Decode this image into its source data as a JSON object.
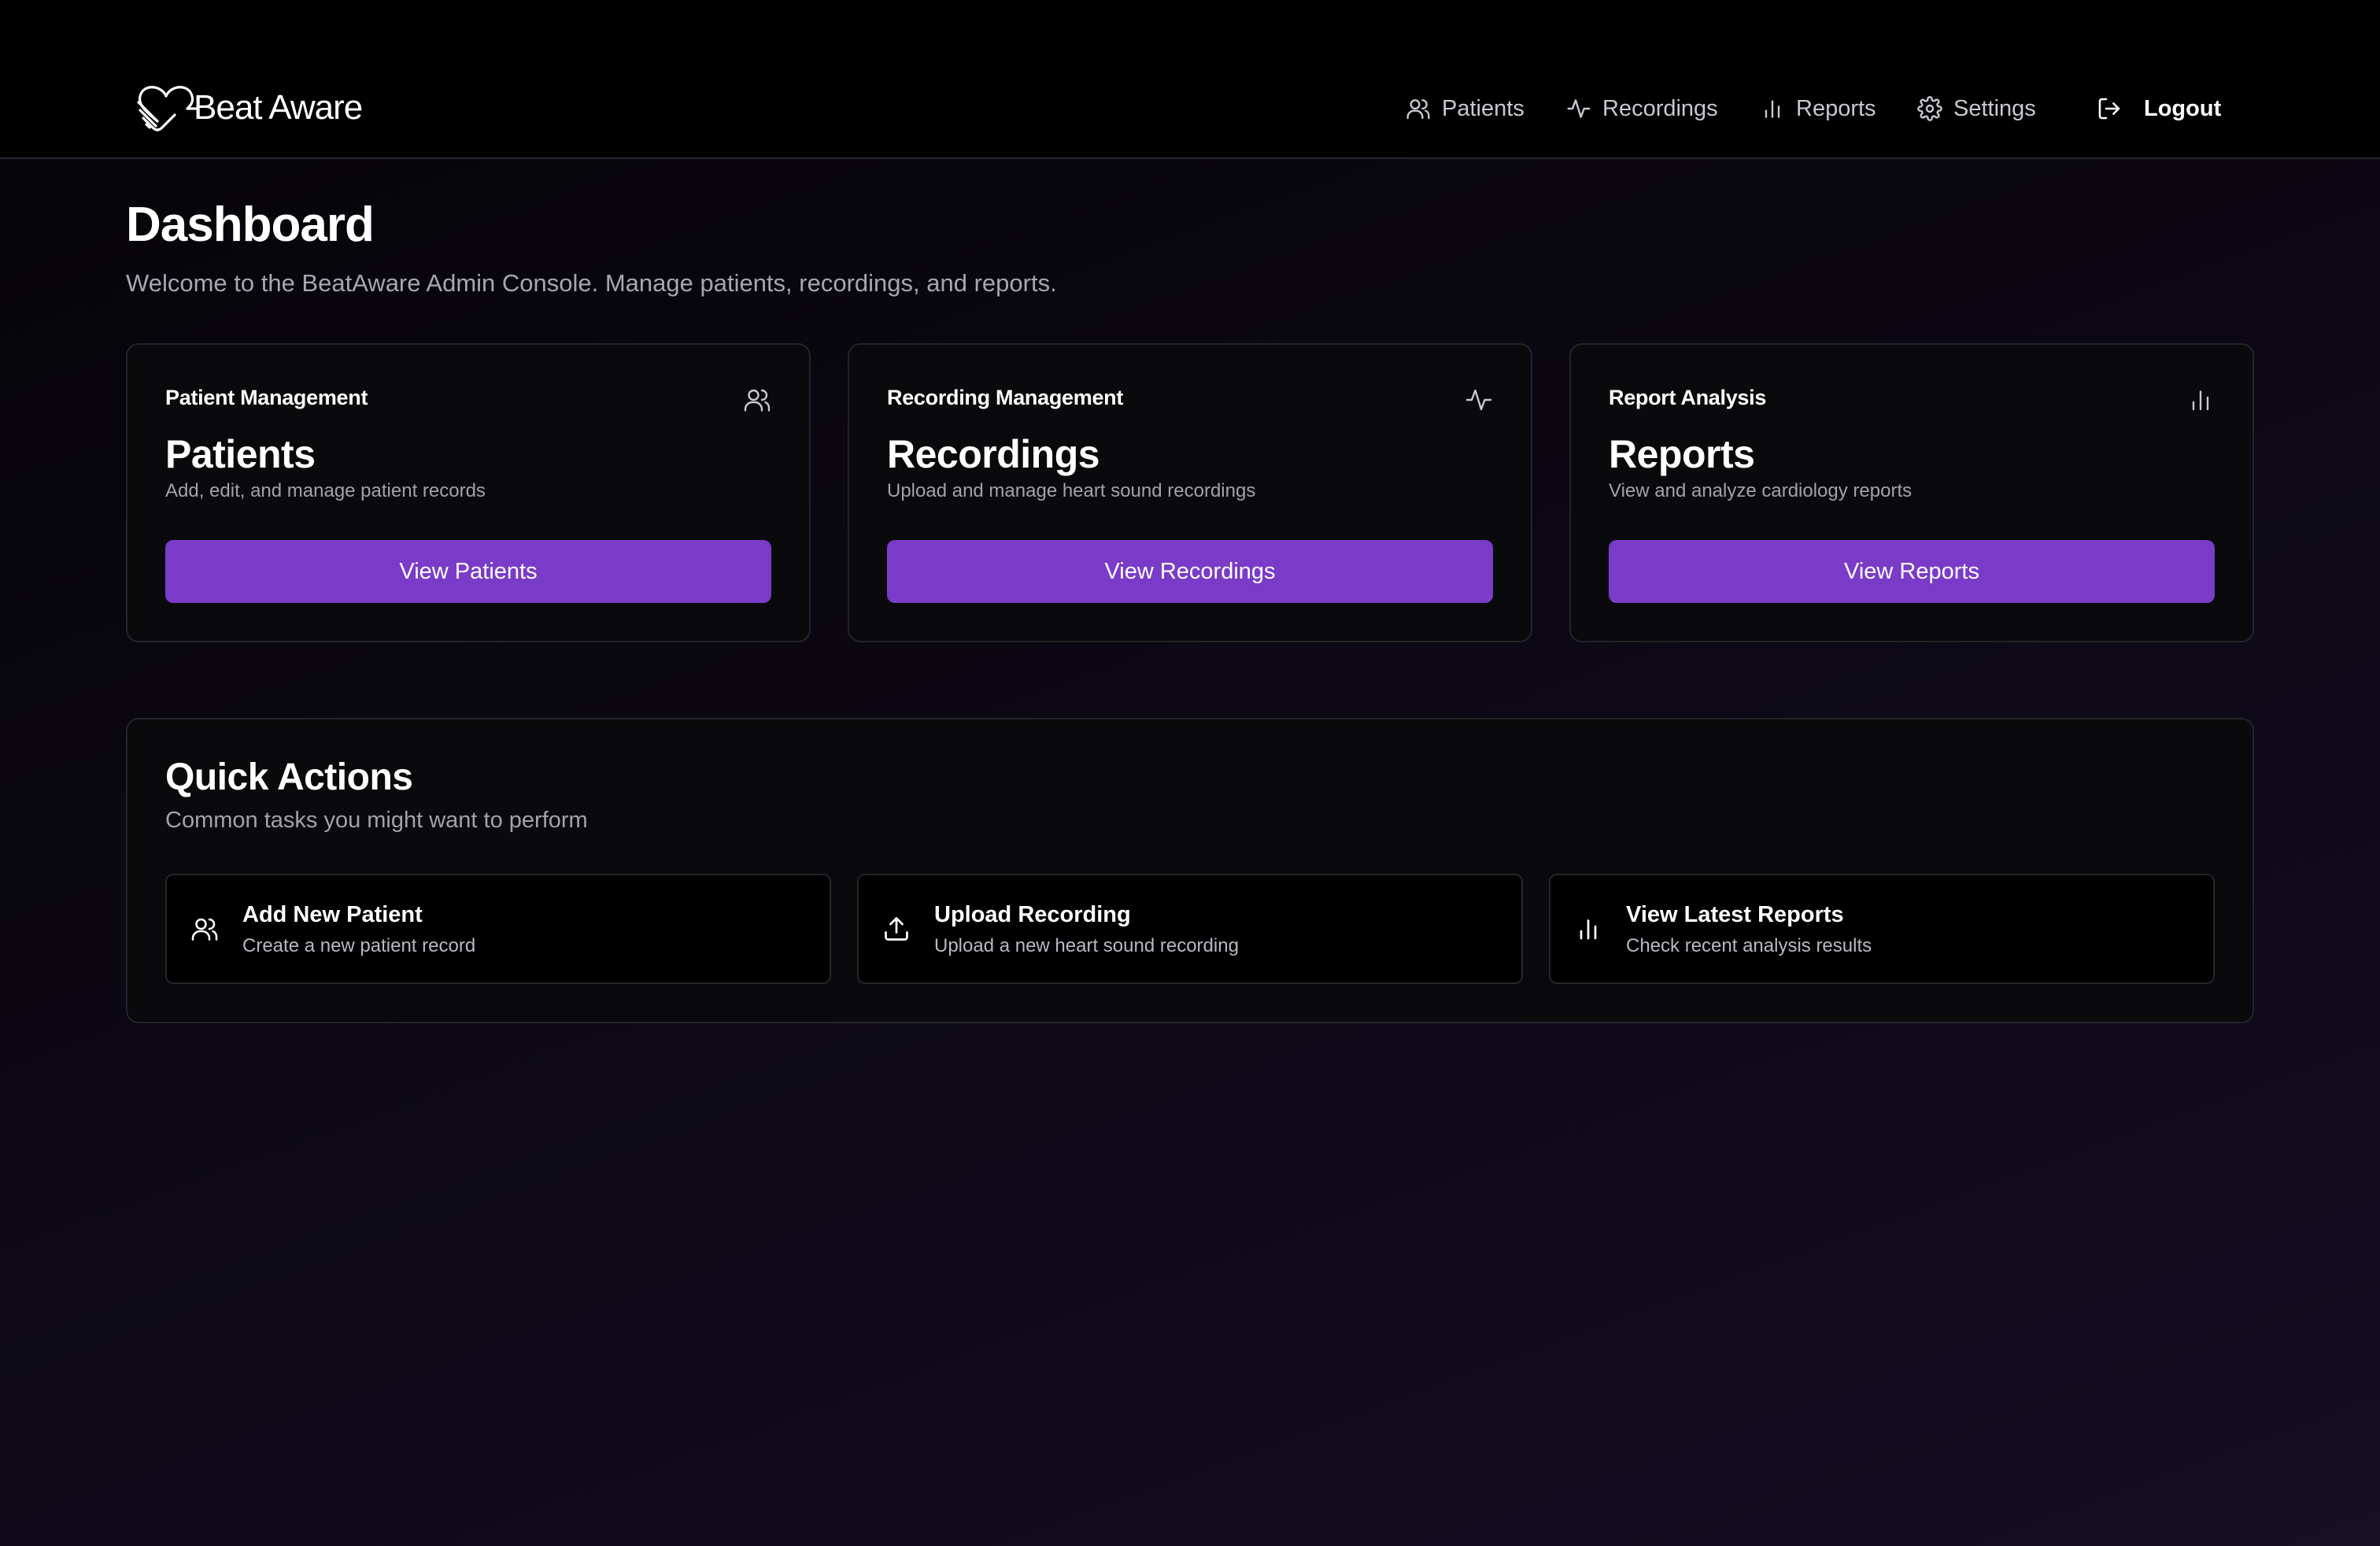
{
  "app": {
    "logo_text": "Beat Aware"
  },
  "nav": {
    "items": [
      {
        "label": "Patients",
        "icon": "users-icon"
      },
      {
        "label": "Recordings",
        "icon": "activity-icon"
      },
      {
        "label": "Reports",
        "icon": "bar-chart-icon"
      },
      {
        "label": "Settings",
        "icon": "gear-icon"
      }
    ],
    "logout_label": "Logout",
    "logout_icon": "logout-icon"
  },
  "page": {
    "title": "Dashboard",
    "subtitle": "Welcome to the BeatAware Admin Console. Manage patients, recordings, and reports."
  },
  "cards": [
    {
      "label": "Patient Management",
      "icon": "users-icon",
      "title": "Patients",
      "description": "Add, edit, and manage patient records",
      "button": "View Patients"
    },
    {
      "label": "Recording Management",
      "icon": "activity-icon",
      "title": "Recordings",
      "description": "Upload and manage heart sound recordings",
      "button": "View Recordings"
    },
    {
      "label": "Report Analysis",
      "icon": "bar-chart-icon",
      "title": "Reports",
      "description": "View and analyze cardiology reports",
      "button": "View Reports"
    }
  ],
  "quick_actions": {
    "title": "Quick Actions",
    "subtitle": "Common tasks you might want to perform",
    "items": [
      {
        "title": "Add New Patient",
        "description": "Create a new patient record",
        "icon": "users-icon"
      },
      {
        "title": "Upload Recording",
        "description": "Upload a new heart sound recording",
        "icon": "upload-icon"
      },
      {
        "title": "View Latest Reports",
        "description": "Check recent analysis results",
        "icon": "bar-chart-icon"
      }
    ]
  },
  "colors": {
    "accent": "#7a3bc8",
    "background": "#0b0812",
    "card": "#0a0a0c",
    "border": "#24232a"
  }
}
